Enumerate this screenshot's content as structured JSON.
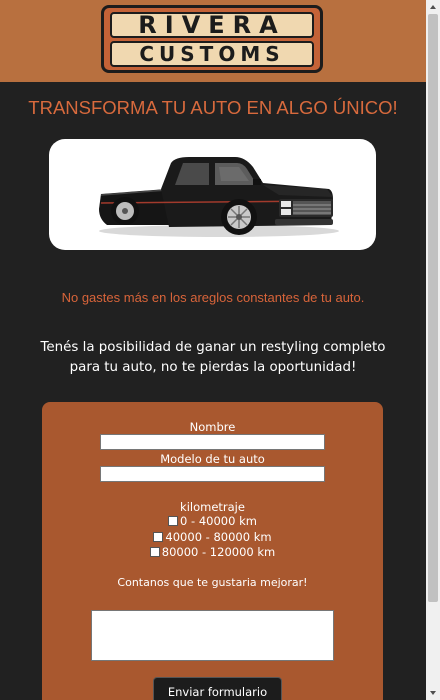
{
  "logo": {
    "line1": "RIVERA",
    "line2": "CUSTOMS"
  },
  "headline": "TRANSFORMA TU AUTO EN ALGO ÚNICO!",
  "hero_image_icon": "lowrider-pickup-truck",
  "subline": "No gastes más en los areglos constantes de tu auto.",
  "description": "Tenés la posibilidad de ganar un restyling completo para tu auto, no te pierdas la oportunidad!",
  "form": {
    "name_label": "Nombre",
    "name_value": "",
    "model_label": "Modelo de tu auto",
    "model_value": "",
    "km_label": "kilometraje",
    "km_options": [
      "0 - 40000 km",
      "40000 - 80000 km",
      "80000 - 120000 km"
    ],
    "improve_label": "Contanos que te gustaria mejorar!",
    "improve_value": "",
    "submit_label": "Enviar formulario"
  },
  "colors": {
    "header_bg": "#b8703f",
    "page_bg": "#212121",
    "accent": "#d86a3d",
    "form_bg": "#a9582f"
  }
}
